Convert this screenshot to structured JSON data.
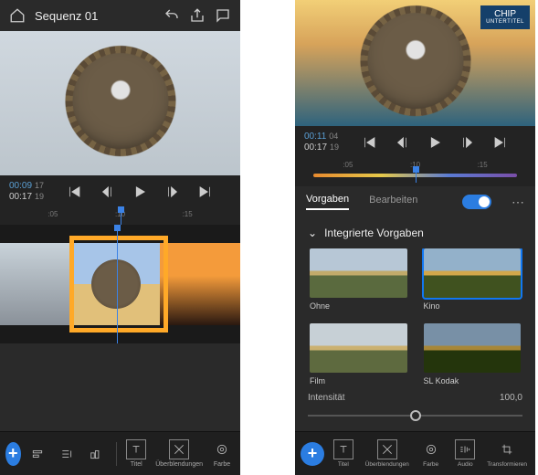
{
  "left": {
    "header": {
      "title": "Sequenz 01"
    },
    "timecode": {
      "current": "00:09",
      "current_frames": "17",
      "total": "00:17",
      "total_frames": "19"
    },
    "ruler": {
      "ticks": [
        ":05",
        ":10",
        ":15"
      ]
    },
    "bottom": {
      "titel": "Titel",
      "uberblendungen": "Überblendungen",
      "farbe": "Farbe"
    }
  },
  "right": {
    "chip": {
      "main": "CHIP",
      "sub": "UNTERTITEL"
    },
    "timecode": {
      "current": "00:11",
      "current_frames": "04",
      "total": "00:17",
      "total_frames": "19"
    },
    "ruler": {
      "ticks": [
        ":05",
        ":10",
        ":15"
      ]
    },
    "tabs": {
      "vorgaben": "Vorgaben",
      "bearbeiten": "Bearbeiten"
    },
    "section": "Integrierte Vorgaben",
    "presets": {
      "ohne": "Ohne",
      "kino": "Kino",
      "film": "Film",
      "kodak": "SL Kodak"
    },
    "intensity": {
      "label": "Intensität",
      "value": "100,0"
    },
    "bottom": {
      "titel": "Titel",
      "uberblendungen": "Überblendungen",
      "farbe": "Farbe",
      "audio": "Audio",
      "transformieren": "Transformieren"
    }
  }
}
